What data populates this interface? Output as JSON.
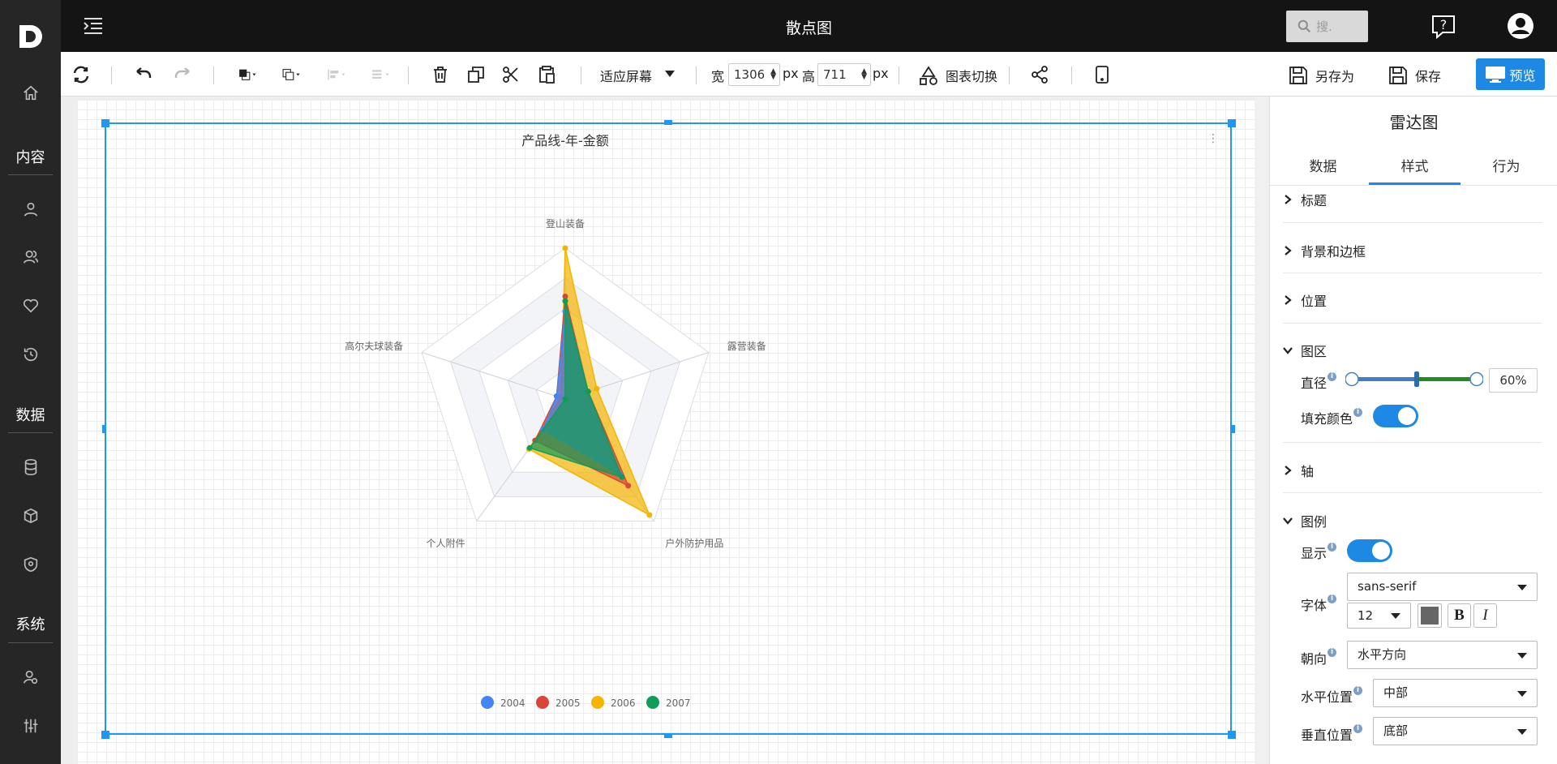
{
  "header": {
    "title": "散点图",
    "search_placeholder": "搜."
  },
  "sidebar": {
    "sections": {
      "content": "内容",
      "data": "数据",
      "system": "系统"
    }
  },
  "toolbar": {
    "fit_label": "适应屏幕",
    "width_label": "宽",
    "width_value": "1306",
    "width_unit": "px",
    "height_label": "高",
    "height_value": "711",
    "height_unit": "px",
    "chart_switch": "图表切换",
    "save_as": "另存为",
    "save": "保存",
    "preview": "预览"
  },
  "panel": {
    "title": "雷达图",
    "tabs": [
      "数据",
      "样式",
      "行为"
    ],
    "active_tab": "样式",
    "sections": {
      "title": "标题",
      "background": "背景和边框",
      "position": "位置",
      "area": "图区",
      "axis": "轴",
      "legend": "图例"
    },
    "diameter_label": "直径",
    "diameter_value": "60%",
    "fill_label": "填充颜色",
    "fill_on": true,
    "legend_show_label": "显示",
    "legend_show": true,
    "font_label": "字体",
    "font_value": "sans-serif",
    "font_size": "12",
    "bold": "B",
    "italic": "I",
    "orient_label": "朝向",
    "orient_value": "水平方向",
    "hpos_label": "水平位置",
    "hpos_value": "中部",
    "vpos_label": "垂直位置",
    "vpos_value": "底部"
  },
  "chart_data": {
    "type": "radar",
    "title": "产品线-年-金额",
    "indicators": [
      "登山装备",
      "露营装备",
      "户外防护用品",
      "个人附件",
      "高尔夫球装备"
    ],
    "series": [
      {
        "name": "2004",
        "color": "#4285f4",
        "values": [
          0.58,
          0.16,
          0.62,
          0.25,
          0.06
        ]
      },
      {
        "name": "2005",
        "color": "#db4437",
        "values": [
          0.68,
          0.16,
          0.71,
          0.34,
          0.06
        ]
      },
      {
        "name": "2006",
        "color": "#f4b400",
        "values": [
          1.0,
          0.22,
          0.95,
          0.41,
          0.03
        ]
      },
      {
        "name": "2007",
        "color": "#0f9d58",
        "values": [
          0.65,
          0.16,
          0.64,
          0.4,
          0.0
        ]
      }
    ],
    "legend_position": "bottom-center"
  }
}
